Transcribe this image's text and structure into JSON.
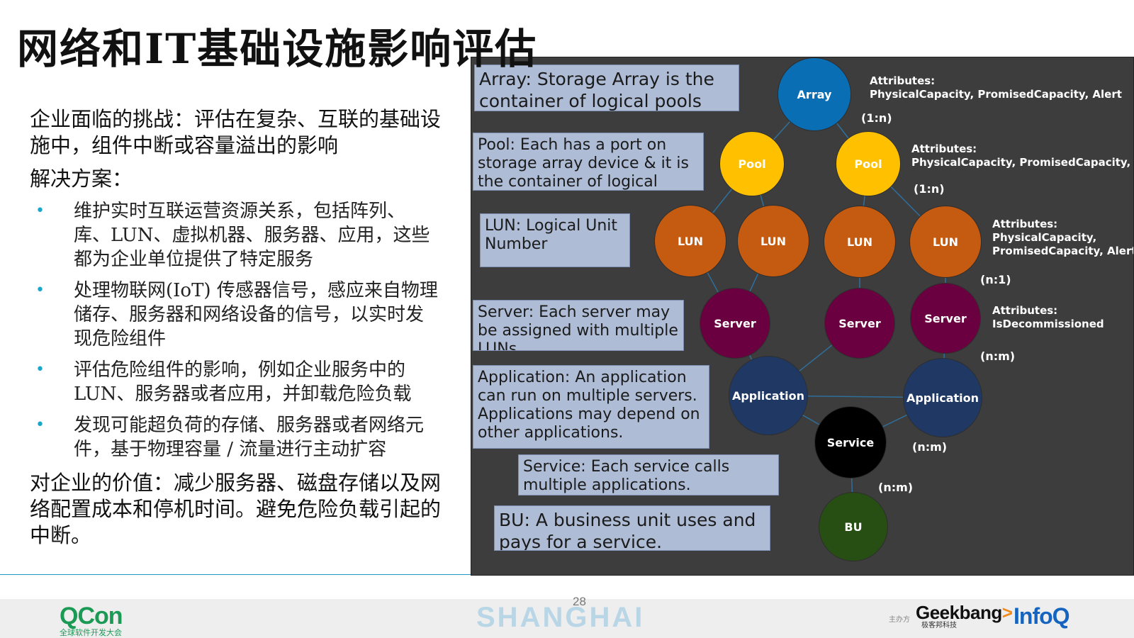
{
  "title": "网络和IT基础设施影响评估",
  "challenge": "企业面临的挑战：评估在复杂、互联的基础设施中，组件中断或容量溢出的影响",
  "solution_heading": "解决方案：",
  "bullets": [
    "维护实时互联运营资源关系，包括阵列、库、LUN、虚拟机器、服务器、应用，这些都为企业单位提供了特定服务",
    "处理物联网(IoT) 传感器信号，感应来自物理储存、服务器和网络设备的信号，以实时发现危险组件",
    "评估危险组件的影响，例如企业服务中的LUN、服务器或者应用，并卸载危险负载",
    "发现可能超负荷的存储、服务器或者网络元件，基于物理容量 / 流量进行主动扩容"
  ],
  "bullet_marker": "•",
  "value": "对企业的价值：减少服务器、磁盘存储以及网络配置成本和停机时间。避免危险负载引起的中断。",
  "descriptions": {
    "array": "Array: Storage Array is the container of logical pools",
    "pool": "Pool: Each has a port on storage array device & it is the container of logical LUNs",
    "lun": "LUN: Logical Unit Number",
    "server": "Server: Each server may be assigned with multiple LUNs",
    "application": "Application: An application can run on multiple servers. Applications may depend on other applications.",
    "service": "Service: Each service calls multiple applications.",
    "bu": "BU: A business unit uses and pays for a service."
  },
  "nodes": {
    "array": "Array",
    "pool": "Pool",
    "lun": "LUN",
    "server": "Server",
    "application": "Application",
    "service": "Service",
    "bu": "BU"
  },
  "attributes": {
    "array_label": "Attributes:",
    "array_values": "PhysicalCapacity, PromisedCapacity, Alert",
    "pool_label": "Attributes:",
    "pool_values": "PhysicalCapacity, PromisedCapacity, Alert",
    "lun_label": "Attributes:",
    "lun_line1": "PhysicalCapacity,",
    "lun_line2": "PromisedCapacity, Alert",
    "server_label": "Attributes:",
    "server_values": "IsDecommissioned"
  },
  "cardinalities": {
    "array_pool": "(1:n)",
    "pool_lun": "(1:n)",
    "lun_server": "(n:1)",
    "server_app": "(n:m)",
    "app_service": "(n:m)",
    "service_bu": "(n:m)"
  },
  "colors": {
    "array": "#0a6eb4",
    "pool": "#ffc000",
    "lun": "#c55a11",
    "server": "#6b0040",
    "application": "#1f3864",
    "service": "#000000",
    "bu": "#274e13",
    "edge": "#2f6f9c"
  },
  "footer": {
    "qcon": "QCon",
    "qcon_sub": "全球软件开发大会",
    "city": "SHANGHAI",
    "page_number": "28",
    "organizer": "主办方",
    "geek_a": "Geek",
    "geek_b": "bang",
    "geek_c": ">",
    "geek_sub": "极客邦科技",
    "infoq": "InfoQ"
  }
}
